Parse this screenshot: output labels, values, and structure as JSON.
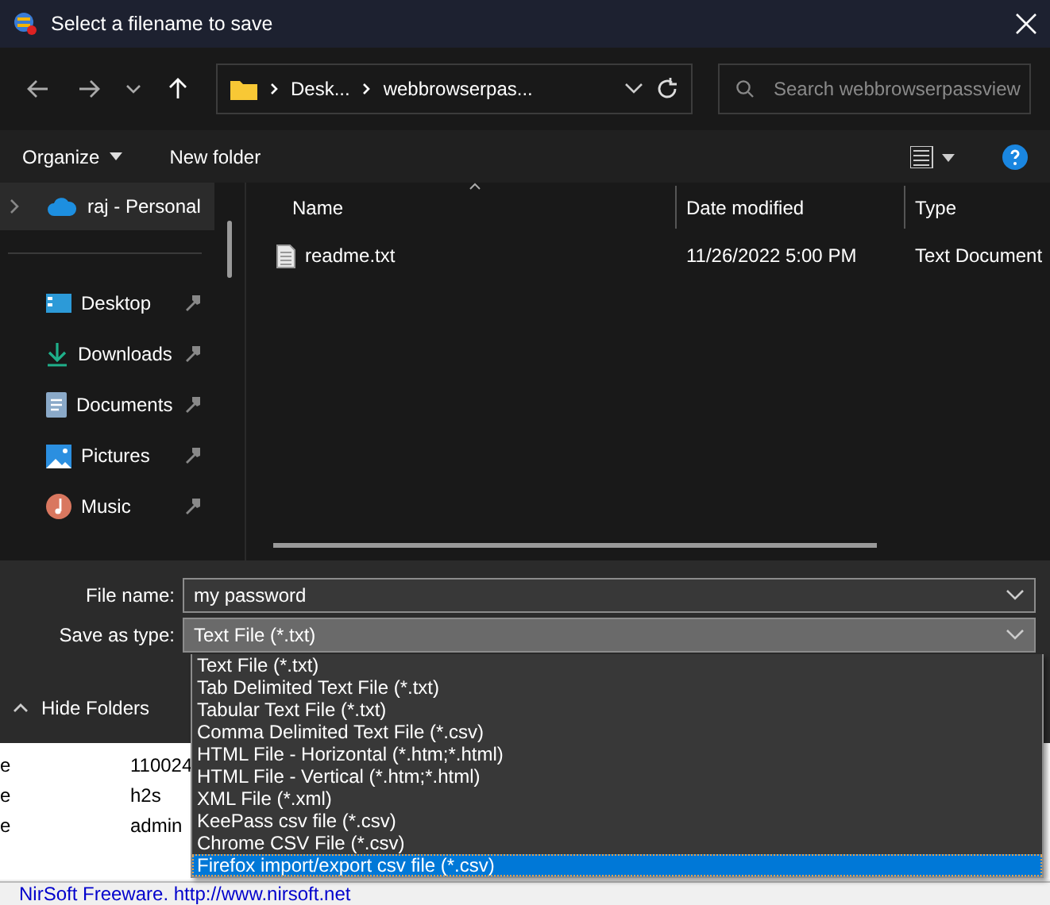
{
  "window": {
    "title": "Select a filename to save"
  },
  "nav": {
    "path": [
      "Desk...",
      "webbrowserpas..."
    ],
    "search": {
      "placeholder": "Search webbrowserpassview"
    }
  },
  "toolbar": {
    "organize": "Organize",
    "new_folder": "New folder"
  },
  "sidebar": {
    "items": [
      {
        "label": "raj - Personal",
        "kind": "cloud",
        "selected": true,
        "pinned": false
      },
      {
        "label": "Desktop",
        "kind": "desktop",
        "selected": false,
        "pinned": true
      },
      {
        "label": "Downloads",
        "kind": "download",
        "selected": false,
        "pinned": true
      },
      {
        "label": "Documents",
        "kind": "document",
        "selected": false,
        "pinned": true
      },
      {
        "label": "Pictures",
        "kind": "pictures",
        "selected": false,
        "pinned": true
      },
      {
        "label": "Music",
        "kind": "music",
        "selected": false,
        "pinned": true
      }
    ]
  },
  "files": {
    "columns": [
      {
        "label": "Name",
        "sorted": true
      },
      {
        "label": "Date modified",
        "sorted": false
      },
      {
        "label": "Type",
        "sorted": false
      }
    ],
    "rows": [
      {
        "name": "readme.txt",
        "date_modified": "11/26/2022 5:00 PM",
        "type": "Text Document"
      }
    ]
  },
  "form": {
    "file_name": {
      "label": "File name:",
      "value": "my password"
    },
    "save_as_type": {
      "label": "Save as type:",
      "value": "Text File (*.txt)",
      "expanded": true,
      "options": [
        {
          "label": "Text File (*.txt)",
          "highlighted": false
        },
        {
          "label": "Tab Delimited Text File (*.txt)",
          "highlighted": false
        },
        {
          "label": "Tabular Text File (*.txt)",
          "highlighted": false
        },
        {
          "label": "Comma Delimited Text File (*.csv)",
          "highlighted": false
        },
        {
          "label": "HTML File - Horizontal (*.htm;*.html)",
          "highlighted": false
        },
        {
          "label": "HTML File - Vertical (*.htm;*.html)",
          "highlighted": false
        },
        {
          "label": "XML File (*.xml)",
          "highlighted": false
        },
        {
          "label": "KeePass csv file (*.csv)",
          "highlighted": false
        },
        {
          "label": "Chrome CSV File (*.csv)",
          "highlighted": false
        },
        {
          "label": "Firefox import/export csv file (*.csv)",
          "highlighted": true
        }
      ]
    }
  },
  "hide_folders": "Hide Folders",
  "background_app": {
    "rows": [
      {
        "column_1": "e",
        "column_2": "110024"
      },
      {
        "column_1": "e",
        "column_2": "h2s"
      },
      {
        "column_1": "e",
        "column_2": "admin"
      }
    ],
    "status_bar": "NirSoft Freeware.  http://www.nirsoft.net"
  }
}
